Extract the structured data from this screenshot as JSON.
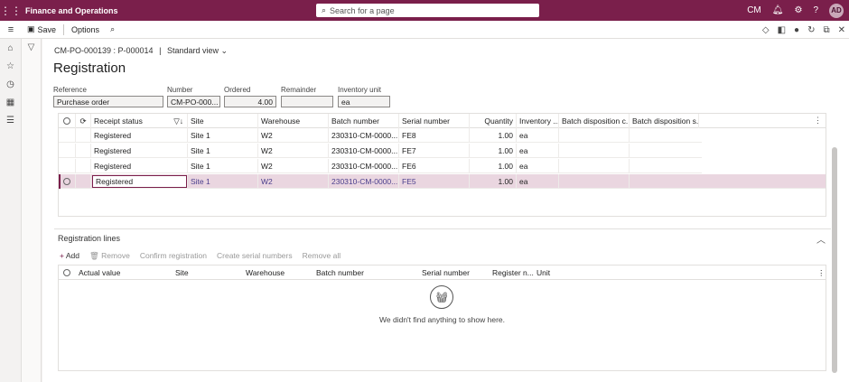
{
  "app": {
    "title": "Finance and Operations",
    "search_placeholder": "Search for a page",
    "company": "CM",
    "user_initials": "AD"
  },
  "actionbar": {
    "save_label": "Save",
    "options_label": "Options"
  },
  "header": {
    "breadcrumb": "CM-PO-000139 : P-000014",
    "view": "Standard view",
    "title": "Registration"
  },
  "fields": {
    "reference": {
      "label": "Reference",
      "value": "Purchase order"
    },
    "number": {
      "label": "Number",
      "value": "CM-PO-000..."
    },
    "ordered": {
      "label": "Ordered",
      "value": "4.00"
    },
    "remainder": {
      "label": "Remainder",
      "value": ""
    },
    "inventory_unit": {
      "label": "Inventory unit",
      "value": "ea"
    }
  },
  "grid": {
    "columns": [
      "Receipt status",
      "Site",
      "Warehouse",
      "Batch number",
      "Serial number",
      "Quantity",
      "Inventory ...",
      "Batch disposition c...",
      "Batch disposition s..."
    ],
    "rows": [
      {
        "status": "Registered",
        "site": "Site 1",
        "warehouse": "W2",
        "batch": "230310-CM-0000...",
        "serial": "FE8",
        "qty": "1.00",
        "unit": "ea"
      },
      {
        "status": "Registered",
        "site": "Site 1",
        "warehouse": "W2",
        "batch": "230310-CM-0000...",
        "serial": "FE7",
        "qty": "1.00",
        "unit": "ea"
      },
      {
        "status": "Registered",
        "site": "Site 1",
        "warehouse": "W2",
        "batch": "230310-CM-0000...",
        "serial": "FE6",
        "qty": "1.00",
        "unit": "ea"
      },
      {
        "status": "Registered",
        "site": "Site 1",
        "warehouse": "W2",
        "batch": "230310-CM-0000...",
        "serial": "FE5",
        "qty": "1.00",
        "unit": "ea"
      }
    ]
  },
  "registration_lines": {
    "title": "Registration lines",
    "actions": {
      "add": "Add",
      "remove": "Remove",
      "confirm": "Confirm registration",
      "create_serials": "Create serial numbers",
      "remove_all": "Remove all"
    },
    "columns": [
      "Actual value",
      "Site",
      "Warehouse",
      "Batch number",
      "Serial number",
      "Register n...",
      "Unit"
    ],
    "empty_message": "We didn't find anything to show here."
  }
}
